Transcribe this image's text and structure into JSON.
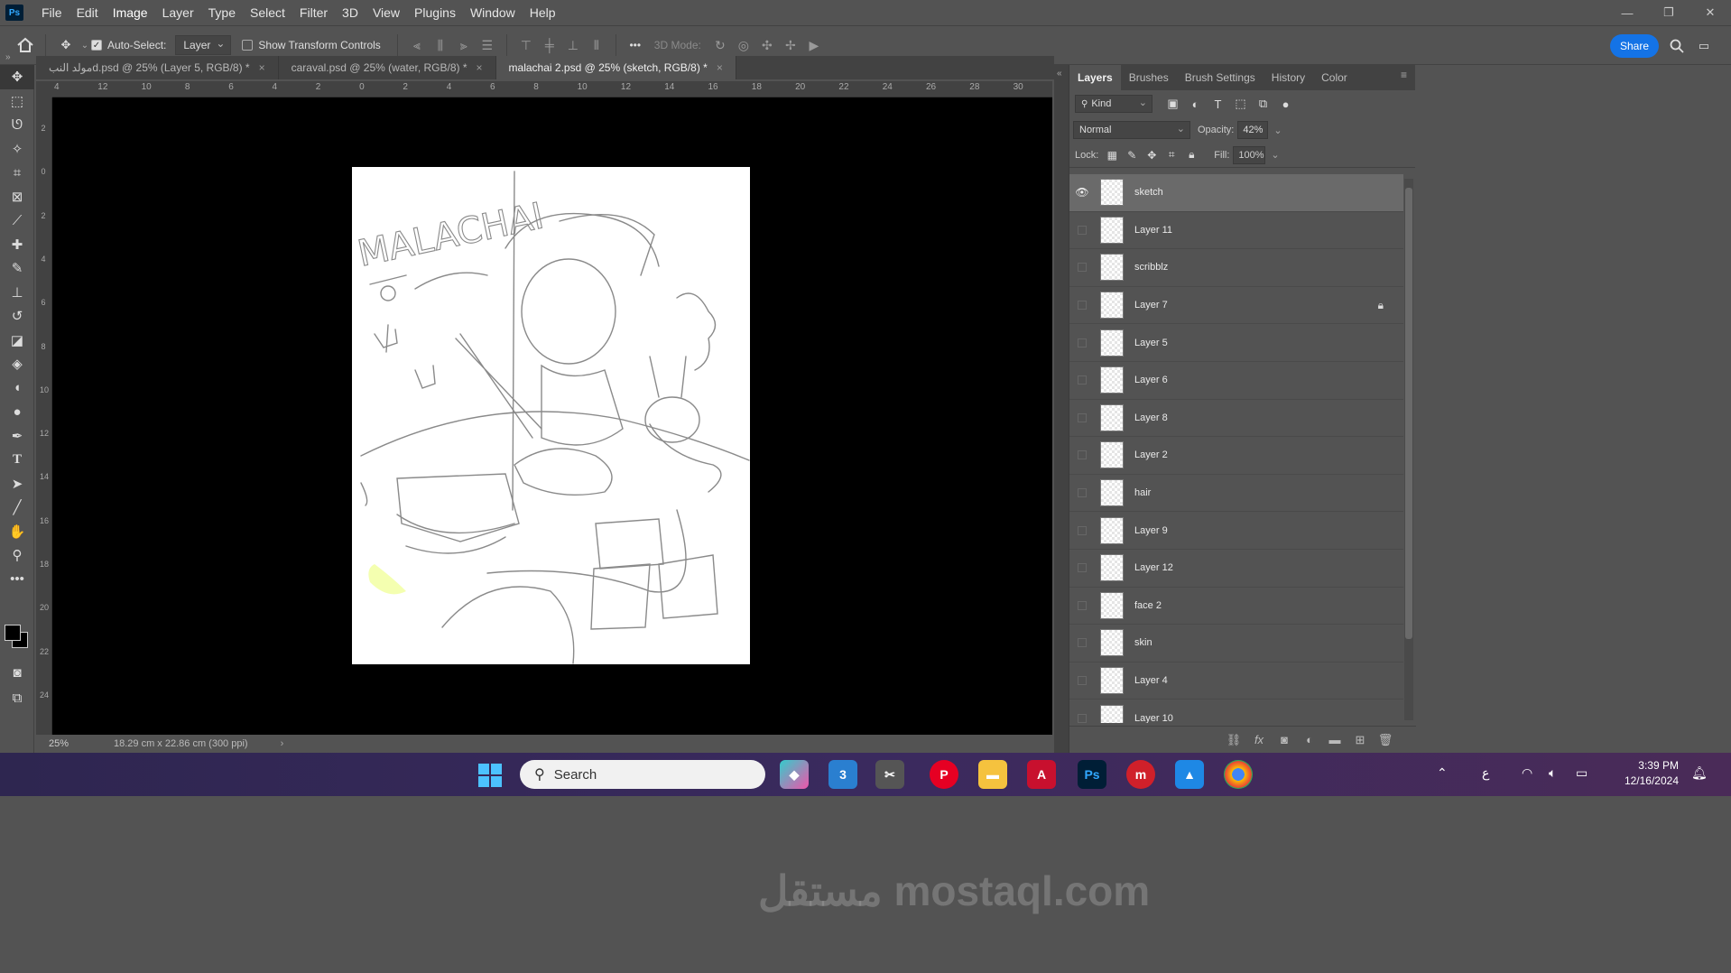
{
  "app": {
    "logo_text": "Ps"
  },
  "menu": [
    "File",
    "Edit",
    "Image",
    "Layer",
    "Type",
    "Select",
    "Filter",
    "3D",
    "View",
    "Plugins",
    "Window",
    "Help"
  ],
  "options": {
    "auto_select_label": "Auto-Select:",
    "auto_select_value": "Layer",
    "show_transform_label": "Show Transform Controls",
    "mode_3d_label": "3D Mode:",
    "more_label": "•••",
    "share_label": "Share"
  },
  "tabs": [
    {
      "label": "مولد النبd.psd @ 25% (Layer 5, RGB/8) *",
      "active": false
    },
    {
      "label": "caraval.psd @ 25% (water, RGB/8) *",
      "active": false
    },
    {
      "label": "malachai 2.psd @ 25% (sketch, RGB/8) *",
      "active": true
    }
  ],
  "ruler_top": [
    "4",
    "12",
    "10",
    "8",
    "6",
    "4",
    "2",
    "0",
    "2",
    "4",
    "6",
    "8",
    "10",
    "12",
    "14",
    "16",
    "18",
    "20",
    "22",
    "24",
    "26",
    "28",
    "30"
  ],
  "ruler_left": [
    "2",
    "0",
    "2",
    "4",
    "6",
    "8",
    "10",
    "12",
    "14",
    "16",
    "18",
    "20",
    "22",
    "24"
  ],
  "status": {
    "zoom": "25%",
    "doc_size": "18.29 cm x 22.86 cm (300 ppi)",
    "arrow": "›"
  },
  "panel": {
    "tabs": [
      "Layers",
      "Brushes",
      "Brush Settings",
      "History",
      "Color"
    ],
    "kind_label": "Kind",
    "blend_mode": "Normal",
    "opacity_label": "Opacity:",
    "opacity_value": "42%",
    "lock_label": "Lock:",
    "fill_label": "Fill:",
    "fill_value": "100%"
  },
  "layers": [
    {
      "name": "sketch",
      "visible": true,
      "selected": true,
      "locked": false
    },
    {
      "name": "Layer 11",
      "visible": false,
      "selected": false,
      "locked": false
    },
    {
      "name": "scribblz",
      "visible": false,
      "selected": false,
      "locked": false
    },
    {
      "name": "Layer 7",
      "visible": false,
      "selected": false,
      "locked": true
    },
    {
      "name": "Layer 5",
      "visible": false,
      "selected": false,
      "locked": false
    },
    {
      "name": "Layer 6",
      "visible": false,
      "selected": false,
      "locked": false
    },
    {
      "name": "Layer 8",
      "visible": false,
      "selected": false,
      "locked": false
    },
    {
      "name": "Layer 2",
      "visible": false,
      "selected": false,
      "locked": false
    },
    {
      "name": "hair",
      "visible": false,
      "selected": false,
      "locked": false
    },
    {
      "name": "Layer 9",
      "visible": false,
      "selected": false,
      "locked": false
    },
    {
      "name": "Layer 12",
      "visible": false,
      "selected": false,
      "locked": false
    },
    {
      "name": "face 2",
      "visible": false,
      "selected": false,
      "locked": false
    },
    {
      "name": "skin",
      "visible": false,
      "selected": false,
      "locked": false
    },
    {
      "name": "Layer 4",
      "visible": false,
      "selected": false,
      "locked": false
    },
    {
      "name": "Layer 10",
      "visible": false,
      "selected": false,
      "locked": false
    }
  ],
  "canvas_text": "MALACHAI",
  "taskbar": {
    "search_placeholder": "Search",
    "time": "3:39 PM",
    "date": "12/16/2024",
    "lang": "ع"
  },
  "watermark": "مستقل mostaql.com",
  "colors": {
    "accent": "#1473e6",
    "panel_bg": "#535353",
    "canvas_bg": "#000000"
  }
}
